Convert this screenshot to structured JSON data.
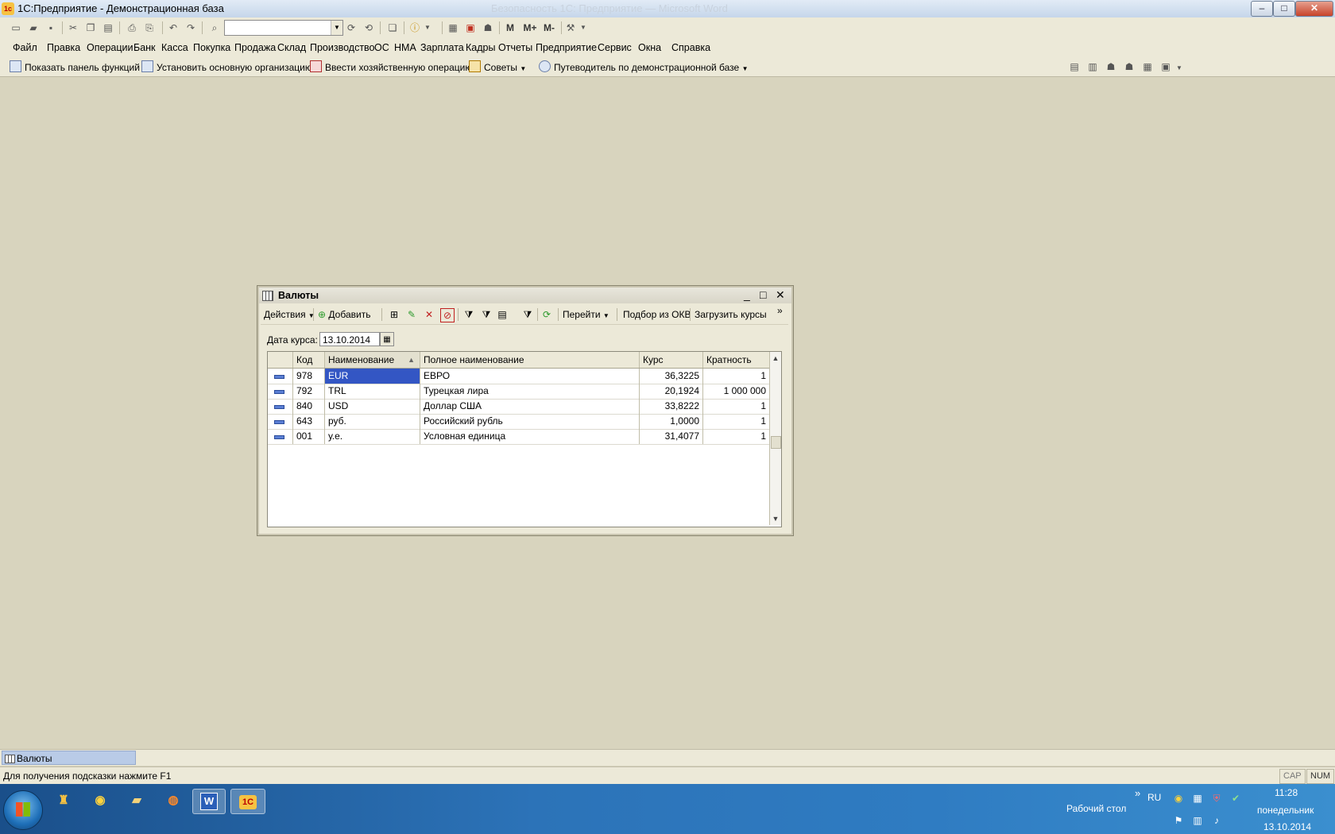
{
  "window": {
    "title": "1С:Предприятие - Демонстрационная база",
    "background_title": "Безопасность 1С: Предприятие — Microsoft Word",
    "app_icon": "1с",
    "buttons": {
      "minimize": "–",
      "maximize": "□",
      "close": "✕"
    }
  },
  "menu": {
    "items": [
      "Файл",
      "Правка",
      "Операции",
      "Банк",
      "Касса",
      "Покупка",
      "Продажа",
      "Склад",
      "Производство",
      "ОС",
      "НМА",
      "Зарплата",
      "Кадры",
      "Отчеты",
      "Предприятие",
      "Сервис",
      "Окна",
      "Справка"
    ]
  },
  "toolbar": {
    "m_buttons": [
      "M",
      "M+",
      "M-"
    ]
  },
  "function_toolbar": {
    "items": [
      "Показать панель функций",
      "Установить основную организацию",
      "Ввести хозяйственную операцию",
      "Советы",
      "Путеводитель по демонстрационной базе"
    ]
  },
  "currencies_window": {
    "title": "Валюты",
    "actions_label": "Действия",
    "add_label": "Добавить",
    "goto_label": "Перейти",
    "okv_label": "Подбор из ОКВ",
    "load_rates_label": "Загрузить курсы",
    "rate_date_label": "Дата курса:",
    "rate_date_value": "13.10.2014",
    "columns": [
      "Код",
      "Наименование",
      "Полное наименование",
      "Курс",
      "Кратность"
    ],
    "rows": [
      {
        "code": "978",
        "name": "EUR",
        "full_name": "ЕВРО",
        "rate": "36,3225",
        "multiplicity": "1"
      },
      {
        "code": "792",
        "name": "TRL",
        "full_name": "Турецкая лира",
        "rate": "20,1924",
        "multiplicity": "1 000 000"
      },
      {
        "code": "840",
        "name": "USD",
        "full_name": "Доллар США",
        "rate": "33,8222",
        "multiplicity": "1"
      },
      {
        "code": "643",
        "name": "руб.",
        "full_name": "Российский рубль",
        "rate": "1,0000",
        "multiplicity": "1"
      },
      {
        "code": "001",
        "name": "у.е.",
        "full_name": "Условная единица",
        "rate": "31,4077",
        "multiplicity": "1"
      }
    ]
  },
  "taskstrip": {
    "tab_label": "Валюты"
  },
  "status": {
    "hint": "Для получения подсказки нажмите F1",
    "cap": "CAP",
    "num": "NUM"
  },
  "taskbar": {
    "desktop_label": "Рабочий стол",
    "lang": "RU",
    "time": "11:28",
    "weekday": "понедельник",
    "date": "13.10.2014",
    "word_label": "W",
    "onec_label": "1С"
  },
  "colors": {
    "selection": "#3356c4",
    "workspace": "#d8d4be",
    "toolbar": "#ece9d8"
  }
}
